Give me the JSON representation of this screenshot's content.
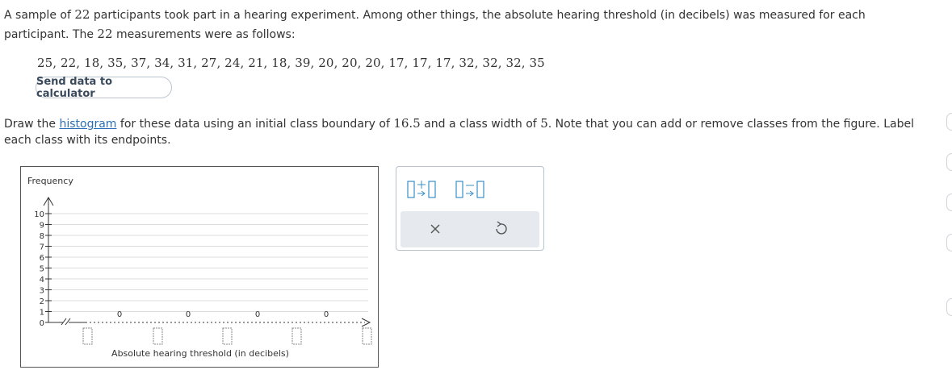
{
  "intro": {
    "part1": "A sample of ",
    "n": "22",
    "part2": " participants took part in a hearing experiment. Among other things, the absolute hearing threshold (in decibels) was measured for each participant. The ",
    "n2": "22",
    "part3": " measurements were as follows:"
  },
  "data_values": "25, 22, 18, 35, 37, 34, 31, 27, 24, 21, 18, 39, 20, 20, 20, 17, 17, 17, 32, 32, 32, 35",
  "send_button": "Send data to calculator",
  "draw": {
    "part1": "Draw the ",
    "link": "histogram",
    "part2": " for these data using an initial class boundary of ",
    "boundary": "16.5",
    "part3": " and a class width of ",
    "width": "5",
    "part4": ". Note that you can add or remove classes from the figure. Label each class with its endpoints."
  },
  "chart_data": {
    "type": "bar",
    "ylabel": "Frequency",
    "xlabel": "Absolute hearing threshold (in decibels)",
    "ylim": [
      0,
      10
    ],
    "y_ticks": [
      0,
      1,
      2,
      3,
      4,
      5,
      6,
      7,
      8,
      9,
      10
    ],
    "bar_values": [
      0,
      0,
      0,
      0
    ],
    "grid": true
  },
  "colors": {
    "link": "#2a6eb6",
    "grid": "#dcdcdc",
    "axis": "#333333",
    "tool_bg": "#e6e9ed"
  },
  "tools": {
    "add_class_icon": "add-class-icon",
    "remove_class_icon": "remove-class-icon",
    "clear_icon": "close-icon",
    "undo_icon": "undo-icon"
  }
}
